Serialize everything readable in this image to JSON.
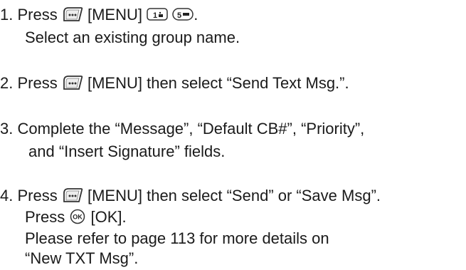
{
  "steps": [
    {
      "number": "1.",
      "press_word": "Press",
      "menu_key_label": "[MENU]",
      "key_1_text": "1",
      "key_5_text": "5",
      "period": ".",
      "line2": "Select an existing group name."
    },
    {
      "number": "2.",
      "text_after_key": "[MENU] then select “Send Text Msg.”."
    },
    {
      "number": "3.",
      "line1": "Complete the “Message”, “Default CB#”, “Priority”,",
      "line2": "and “Insert Signature” fields."
    },
    {
      "number": "4.",
      "text_after_key": "[MENU] then select “Send” or “Save Msg”.",
      "line2_press": "Press",
      "ok_key_text": "OK",
      "ok_label": "[OK].",
      "line3": "Please refer to page 113 for more details on",
      "line4": "“New TXT Msg”."
    }
  ],
  "icons": {
    "menu_key": "menu-softkey-icon",
    "ok_key": "ok-button-icon",
    "key_1": "keypad-1-icon",
    "key_5": "keypad-5-icon"
  }
}
